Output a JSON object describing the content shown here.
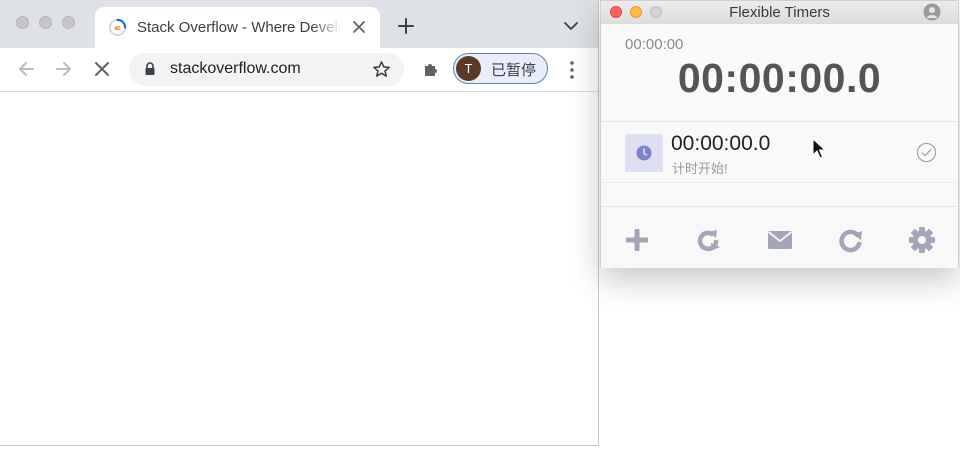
{
  "browser": {
    "tab": {
      "title": "Stack Overflow - Where Developers Learn, Share, & Build Careers"
    },
    "address": {
      "url": "stackoverflow.com"
    },
    "profile": {
      "initial": "T",
      "status": "已暂停"
    }
  },
  "timer_app": {
    "title": "Flexible Timers",
    "summary": {
      "small_time": "00:00:00",
      "big_time": "00:00:00.0"
    },
    "timers": [
      {
        "time": "00:00:00.0",
        "label": "计时开始!"
      }
    ],
    "footer": [
      "add-icon",
      "restart-icon",
      "mail-icon",
      "refresh-icon",
      "settings-icon"
    ]
  },
  "colors": {
    "tab_strip": "#dee1e6",
    "profile_border": "#5f7fb0",
    "timer_icon_bg": "#dde0f2",
    "timer_icon": "#7c84c8",
    "footer_icons": "#a3a6b8"
  }
}
